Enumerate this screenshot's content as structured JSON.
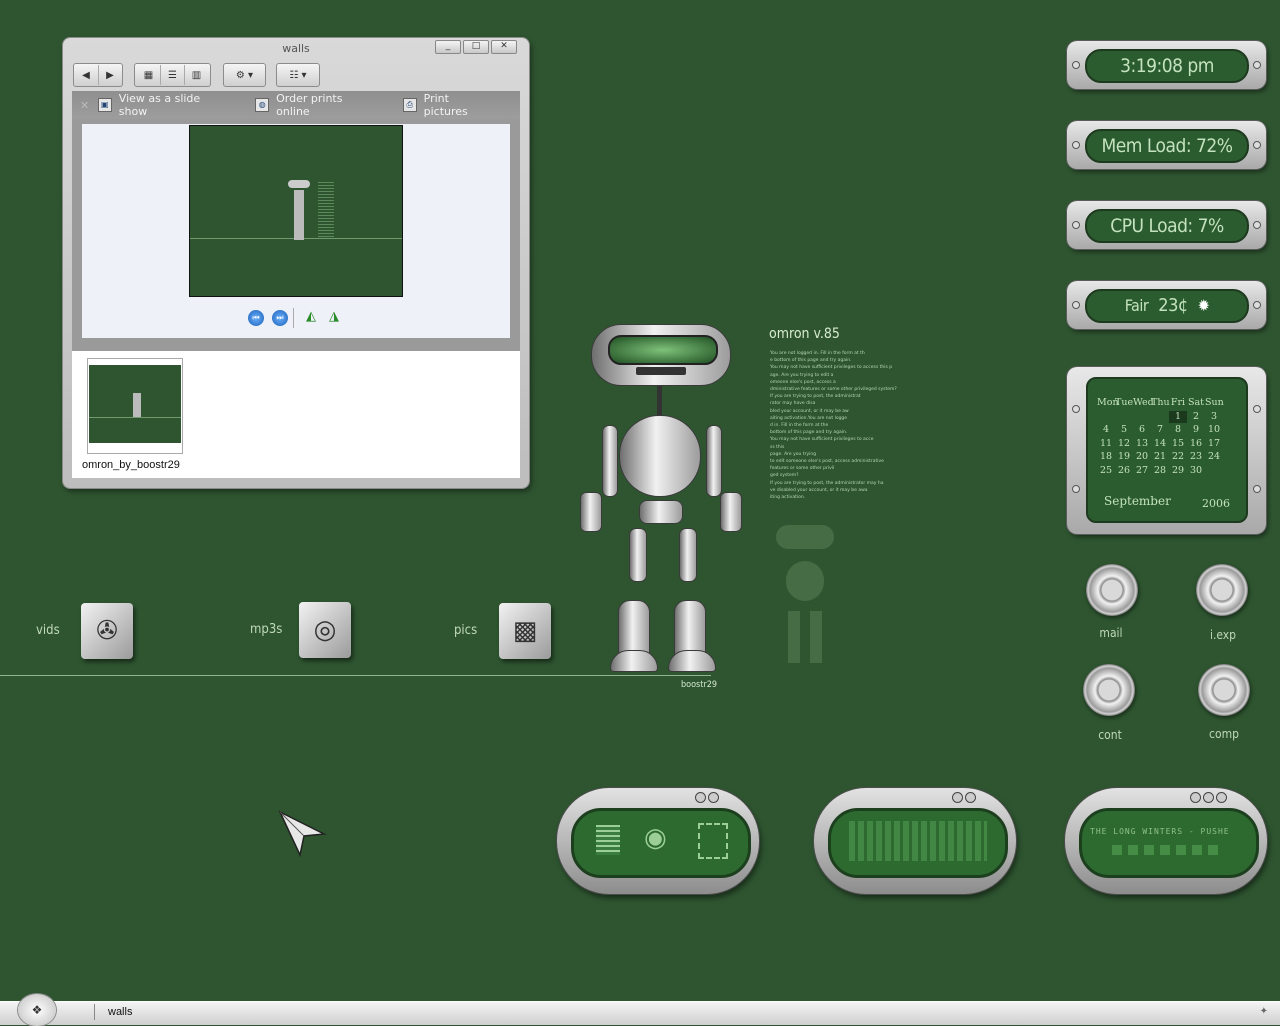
{
  "window": {
    "title": "walls",
    "controls": {
      "minimize": "_",
      "maximize": "□",
      "close": "✕"
    },
    "tasks": [
      {
        "label": "View as a slide show",
        "icon": "slideshow-icon"
      },
      {
        "label": "Order prints online",
        "icon": "globe-icon"
      },
      {
        "label": "Print pictures",
        "icon": "printer-icon"
      }
    ],
    "thumbnail": {
      "label": "omron_by_boostr29"
    }
  },
  "widgets": {
    "clock": "3:19:08 pm",
    "mem_load": "Mem Load: 72%",
    "cpu_load": "CPU Load: 7%",
    "weather": {
      "condition": "Fair",
      "temp": "23¢",
      "icon": "sun-icon"
    }
  },
  "calendar": {
    "days": [
      "Mon",
      "Tue",
      "Wed",
      "Thu",
      "Fri",
      "Sat",
      "Sun"
    ],
    "cells": [
      "",
      "",
      "",
      "",
      "1",
      "2",
      "3",
      "4",
      "5",
      "6",
      "7",
      "8",
      "9",
      "10",
      "11",
      "12",
      "13",
      "14",
      "15",
      "16",
      "17",
      "18",
      "19",
      "20",
      "21",
      "22",
      "23",
      "24",
      "25",
      "26",
      "27",
      "28",
      "29",
      "30",
      ""
    ],
    "today": "1",
    "month": "September",
    "year": "2006"
  },
  "knobs": [
    {
      "label": "mail"
    },
    {
      "label": "i.exp"
    },
    {
      "label": "cont"
    },
    {
      "label": "comp"
    }
  ],
  "shelf": [
    {
      "label": "vids",
      "icon": "film-reel-icon"
    },
    {
      "label": "mp3s",
      "icon": "cd-icon"
    },
    {
      "label": "pics",
      "icon": "film-roll-icon"
    }
  ],
  "robot": {
    "title": "omron v.85",
    "credit": "boostr29",
    "lines": [
      "You are not logged in. Fill in the form at th",
      "e bottom of this page and try again.",
      "You may not have sufficient privileges to access this p",
      "age. Are you trying to edit a",
      "omeone else's post, access a",
      "dministrative features or some other privileged system?",
      "If you are trying to post, the administrat",
      "rator may have disa",
      "bled your account, or it may be aw",
      "aiting activation.You are not logge",
      "d in. Fill in the form at the",
      "bottom of this page and try again.",
      "You may not have sufficient privileges to acce",
      "ss this",
      "page. Are you trying",
      "to edit someone else's post, access administrative",
      "features or some other privil",
      "ged system?",
      "If you are trying to post, the administrator may ha",
      "ve disabled your account, or it may be awa",
      "iting activation."
    ]
  },
  "player": {
    "marquee": "THE LONG WINTERS - PUSHE"
  },
  "taskbar": {
    "item": "walls"
  }
}
